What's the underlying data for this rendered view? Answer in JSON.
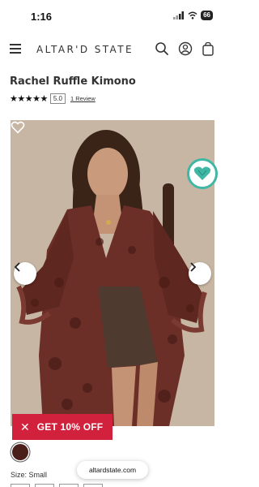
{
  "status": {
    "time": "1:16",
    "battery": "66"
  },
  "header": {
    "brand": "ALTAR'D STATE",
    "icons": [
      "menu-icon",
      "search-icon",
      "account-icon",
      "bag-icon"
    ]
  },
  "product": {
    "title": "Rachel Ruffle Kimono",
    "stars": "★★★★★",
    "rating": "5.0",
    "review_link": "1 Review",
    "color_swatch": "#4a1f1a",
    "size_label": "Size: Small"
  },
  "promo": {
    "label": "GET 10% OFF",
    "close": "✕",
    "color": "#d1213c"
  },
  "browser": {
    "url": "altardstate.com"
  },
  "colors": {
    "accent_teal": "#3fb7a4",
    "promo_red": "#d1213c"
  }
}
